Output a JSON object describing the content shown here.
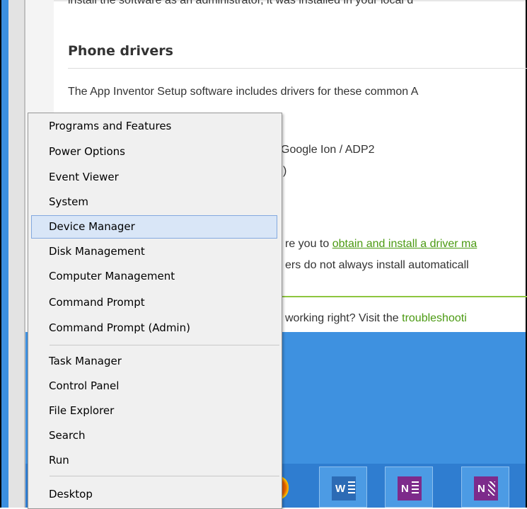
{
  "page": {
    "cut_text": "install the software as an administrator, it was installed in your local d",
    "heading": "Phone drivers",
    "intro": "The App Inventor Setup software includes drivers for these common A",
    "driver_line_1": "Google Ion / ADP2",
    "driver_line_2": ")",
    "need_prefix": "re you to",
    "need_link": "obtain and install a driver ma",
    "auto_text": "ers do not always install automaticall",
    "trouble_prefix": "working right? Visit the",
    "trouble_link": "troubleshooti"
  },
  "menu": {
    "items": [
      {
        "label": "Programs and Features"
      },
      {
        "label": "Power Options"
      },
      {
        "label": "Event Viewer"
      },
      {
        "label": "System"
      },
      {
        "label": "Device Manager",
        "selected": true
      },
      {
        "label": "Disk Management"
      },
      {
        "label": "Computer Management"
      },
      {
        "label": "Command Prompt"
      },
      {
        "label": "Command Prompt (Admin)"
      },
      {
        "label": "Task Manager"
      },
      {
        "label": "Control Panel"
      },
      {
        "label": "File Explorer"
      },
      {
        "label": "Search"
      },
      {
        "label": "Run"
      },
      {
        "label": "Desktop"
      }
    ]
  },
  "taskbar": {
    "apps": [
      {
        "name": "firefox",
        "icon": "firefox-icon"
      },
      {
        "name": "word",
        "icon": "word-icon",
        "letter": "W"
      },
      {
        "name": "onenote",
        "icon": "onenote-icon",
        "letter": "N"
      },
      {
        "name": "onenote-clipping",
        "icon": "onenote-clipping-icon",
        "letter": "N"
      }
    ]
  },
  "colors": {
    "accent_blue": "#3e91e0",
    "link_green": "#4b9a12",
    "menu_highlight": "#d9e6f7"
  }
}
